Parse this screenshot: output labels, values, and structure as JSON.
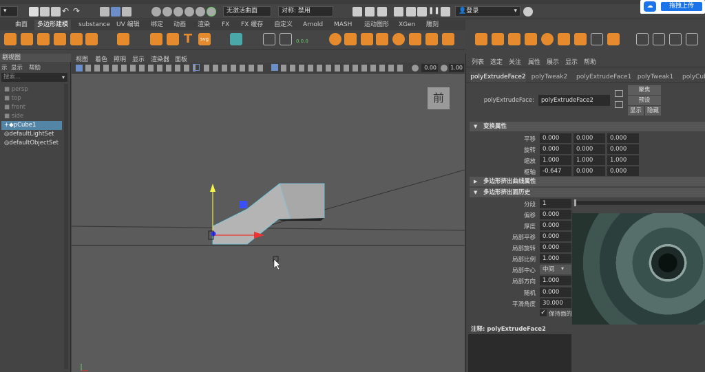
{
  "statusline": {
    "layout_value": "无激活曲面",
    "symmetry": "对称: 禁用",
    "login": "登录"
  },
  "shelf_tabs": [
    "曲面",
    "多边形建模",
    "substance",
    "UV 编辑",
    "绑定",
    "动画",
    "渲染",
    "FX",
    "FX 缓存",
    "自定义",
    "Arnold",
    "MASH",
    "运动图形",
    "XGen",
    "雕刻"
  ],
  "outliner": {
    "title": "剔视图",
    "menu": [
      "示",
      "显示",
      "帮助"
    ],
    "search_placeholder": "搜索...",
    "items": [
      "persp",
      "top",
      "front",
      "side",
      "pCube1",
      "defaultLightSet",
      "defaultObjectSet"
    ]
  },
  "viewport": {
    "menu": [
      "视图",
      "着色",
      "照明",
      "显示",
      "渲染器",
      "面板"
    ],
    "field1": "0.00",
    "field2": "1.00",
    "view_cube_label": "前"
  },
  "attribute_editor": {
    "menu": [
      "列表",
      "选定",
      "关注",
      "属性",
      "展示",
      "显示",
      "帮助"
    ],
    "tabs": [
      "polyExtrudeFace2",
      "polyTweak2",
      "polyExtrudeFace1",
      "polyTweak1",
      "polyCub"
    ],
    "node_label": "polyExtrudeFace:",
    "node_value": "polyExtrudeFace2",
    "buttons": [
      "聚焦",
      "预设",
      "显示",
      "隐藏"
    ],
    "sections": {
      "transform": "变换属性",
      "curve": "多边形挤出曲线属性",
      "history": "多边形挤出面历史"
    },
    "transform_rows": [
      {
        "label": "平移",
        "values": [
          "0.000",
          "0.000",
          "0.000"
        ]
      },
      {
        "label": "旋转",
        "values": [
          "0.000",
          "0.000",
          "0.000"
        ]
      },
      {
        "label": "缩放",
        "values": [
          "1.000",
          "1.000",
          "1.000"
        ]
      },
      {
        "label": "枢轴",
        "values": [
          "-0.647",
          "0.000",
          "0.000"
        ]
      }
    ],
    "history_rows": [
      {
        "label": "分段",
        "value": "1"
      },
      {
        "label": "偏移",
        "value": "0.000"
      },
      {
        "label": "厚度",
        "value": "0.000"
      },
      {
        "label": "局部平移",
        "value": "0.000"
      },
      {
        "label": "局部旋转",
        "value": "0.000"
      },
      {
        "label": "局部比例",
        "value": "1.000"
      },
      {
        "label": "局部中心",
        "value": "中间"
      },
      {
        "label": "局部方向",
        "value": "1.000"
      },
      {
        "label": "随机",
        "value": "0.000"
      },
      {
        "label": "平滑角度",
        "value": "30.000"
      }
    ],
    "checkbox_label": "保持面的",
    "notes_label": "注释: polyExtrudeFace2"
  },
  "upload_badge": "拖拽上传"
}
